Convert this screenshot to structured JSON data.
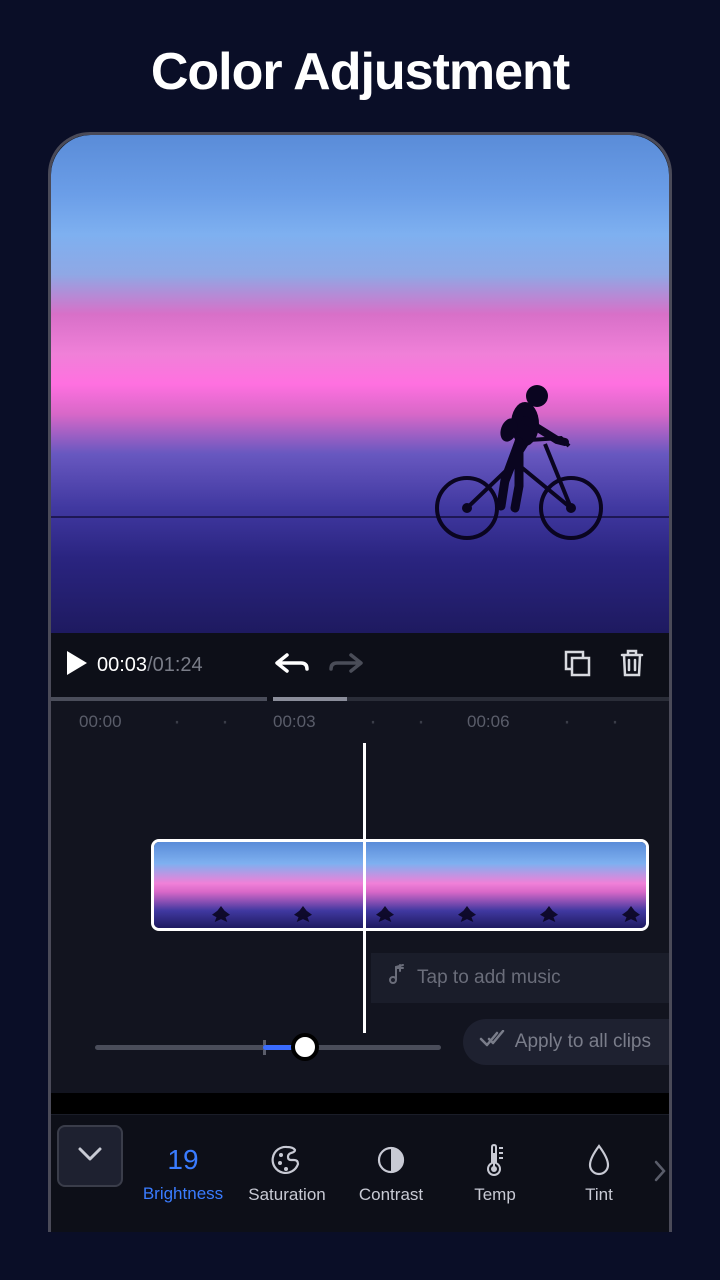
{
  "page_title": "Color Adjustment",
  "transport": {
    "current_time": "00:03",
    "total_time": "01:24"
  },
  "ruler": {
    "marks": [
      "00:00",
      "00:03",
      "00:06"
    ]
  },
  "music_prompt": "Tap to add music",
  "apply_all_label": "Apply to all clips",
  "slider": {
    "value": 19,
    "min": -100,
    "max": 100
  },
  "adjustments": {
    "active_index": 0,
    "items": [
      {
        "label": "Brightness",
        "value": "19"
      },
      {
        "label": "Saturation"
      },
      {
        "label": "Contrast"
      },
      {
        "label": "Temp"
      },
      {
        "label": "Tint"
      }
    ]
  }
}
